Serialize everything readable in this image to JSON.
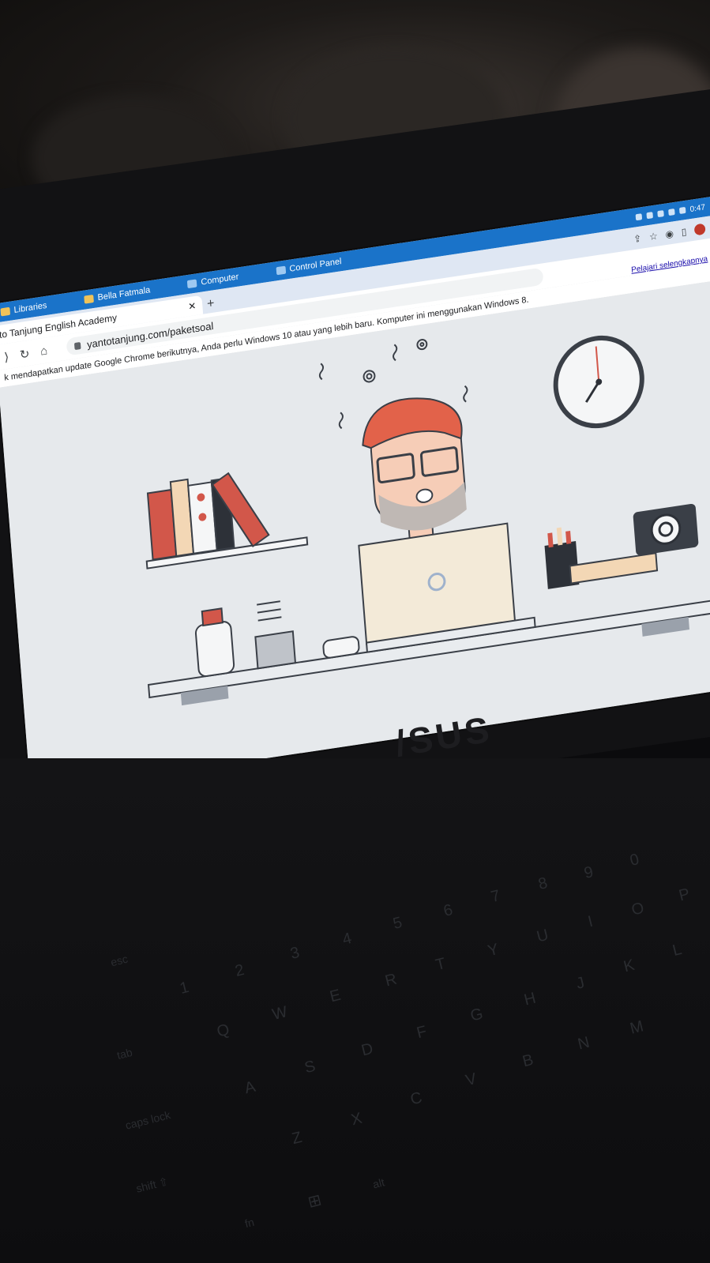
{
  "windows_taskbar": {
    "items": [
      "Libraries",
      "Bella Fatmala",
      "Computer",
      "Control Panel"
    ],
    "clock": "0:47"
  },
  "chrome": {
    "tab_title": "to Tanjung English Academy",
    "tab_close": "✕",
    "new_tab": "+",
    "url": "yantotanjung.com/paketsoal",
    "learn_more": "Pelajari selengkapnya",
    "infobar_text": "k mendapatkan update Google Chrome berikutnya, Anda perlu Windows 10 atau yang lebih baru. Komputer ini menggunakan Windows 8.",
    "nav_icons": [
      "back-icon",
      "reload-icon",
      "home-icon"
    ]
  },
  "laptop": {
    "brand": "/SUS"
  },
  "keyboard": {
    "keys": [
      "esc",
      "1",
      "2",
      "3",
      "4",
      "5",
      "6",
      "7",
      "8",
      "9",
      "0",
      "P",
      "Q",
      "W",
      "E",
      "R",
      "T",
      "Y",
      "U",
      "I",
      "O",
      "tab",
      "A",
      "S",
      "D",
      "F",
      "G",
      "H",
      "J",
      "K",
      "L",
      "caps lock",
      "Z",
      "X",
      "C",
      "V",
      "B",
      "N",
      "M",
      "shift ⇧",
      "fn",
      "alt"
    ]
  },
  "colors": {
    "taskbar": "#1a73c9",
    "hair": "#e2624a",
    "book_red": "#d2574a",
    "desk": "#c9ced6"
  }
}
